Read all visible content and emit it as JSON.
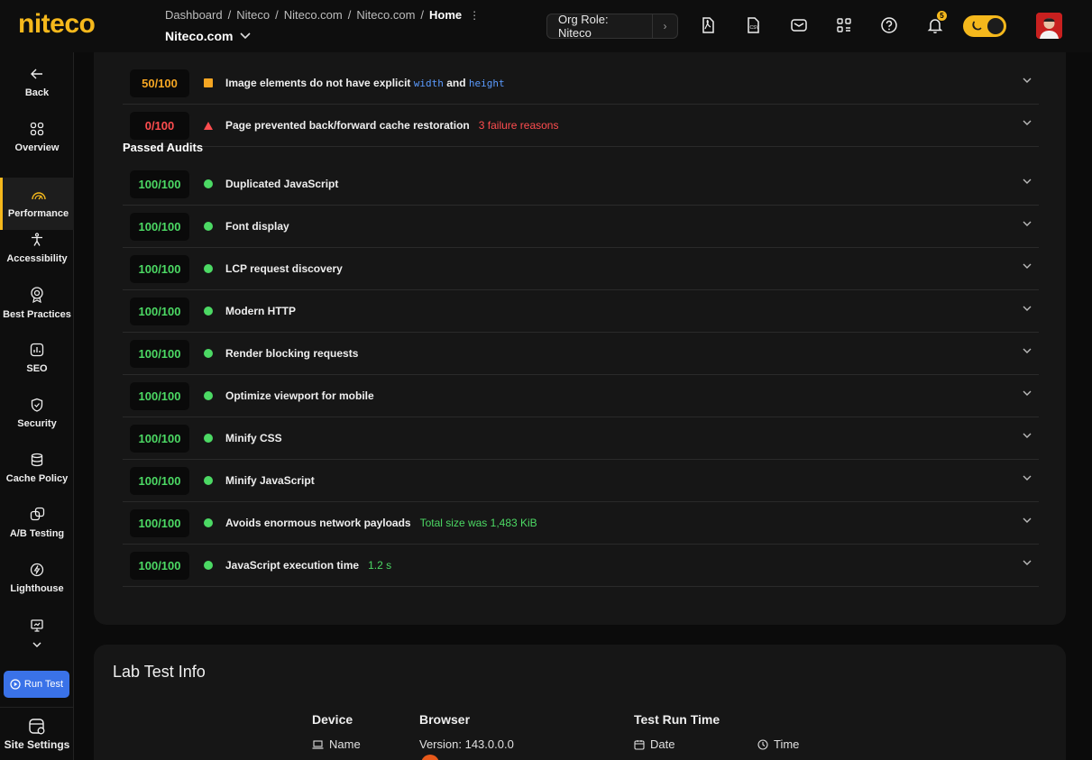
{
  "app": {
    "logo": "niteco",
    "accent": "#f5b81c"
  },
  "breadcrumb": [
    "Dashboard",
    "Niteco",
    "Niteco.com",
    "Niteco.com"
  ],
  "breadcrumb_current": "Home",
  "site_select": "Niteco.com",
  "org_role": "Org Role: Niteco",
  "notifications_count": "5",
  "sidebar": {
    "items": [
      {
        "label": "Back",
        "icon": "arrow-left-icon"
      },
      {
        "label": "Overview",
        "icon": "grid-icon"
      },
      {
        "label": "Performance",
        "icon": "gauge-icon",
        "active": true
      },
      {
        "label": "Accessibility",
        "icon": "accessibility-icon"
      },
      {
        "label": "Best Practices",
        "icon": "award-icon"
      },
      {
        "label": "SEO",
        "icon": "bar-chart-icon"
      },
      {
        "label": "Security",
        "icon": "shield-icon"
      },
      {
        "label": "Cache Policy",
        "icon": "database-icon"
      },
      {
        "label": "A/B Testing",
        "icon": "ab-test-icon"
      },
      {
        "label": "Lighthouse",
        "icon": "lighthouse-icon"
      }
    ],
    "run_test": "Run Test",
    "site_settings": "Site Settings"
  },
  "audits_failed": [
    {
      "score": "50/100",
      "level": "orange",
      "title": "Image elements do not have explicit",
      "code1": "width",
      "and": "and",
      "code2": "height",
      "extra": ""
    },
    {
      "score": "0/100",
      "level": "red",
      "title": "Page prevented back/forward cache restoration",
      "extra": "3 failure reasons"
    }
  ],
  "passed_heading": "Passed Audits",
  "audits_passed": [
    {
      "score": "100/100",
      "title": "Duplicated JavaScript",
      "extra": ""
    },
    {
      "score": "100/100",
      "title": "Font display",
      "extra": ""
    },
    {
      "score": "100/100",
      "title": "LCP request discovery",
      "extra": ""
    },
    {
      "score": "100/100",
      "title": "Modern HTTP",
      "extra": ""
    },
    {
      "score": "100/100",
      "title": "Render blocking requests",
      "extra": ""
    },
    {
      "score": "100/100",
      "title": "Optimize viewport for mobile",
      "extra": ""
    },
    {
      "score": "100/100",
      "title": "Minify CSS",
      "extra": ""
    },
    {
      "score": "100/100",
      "title": "Minify JavaScript",
      "extra": ""
    },
    {
      "score": "100/100",
      "title": "Avoids enormous network payloads",
      "extra": "Total size was 1,483 KiB"
    },
    {
      "score": "100/100",
      "title": "JavaScript execution time",
      "extra": "1.2 s"
    }
  ],
  "lab_test": {
    "title": "Lab Test Info",
    "device_h": "Device",
    "device_v": "Name",
    "browser_h": "Browser",
    "browser_v": "Version: 143.0.0.0",
    "run_time_h": "Test Run Time",
    "date_v": "Date",
    "time_v": "Time"
  }
}
